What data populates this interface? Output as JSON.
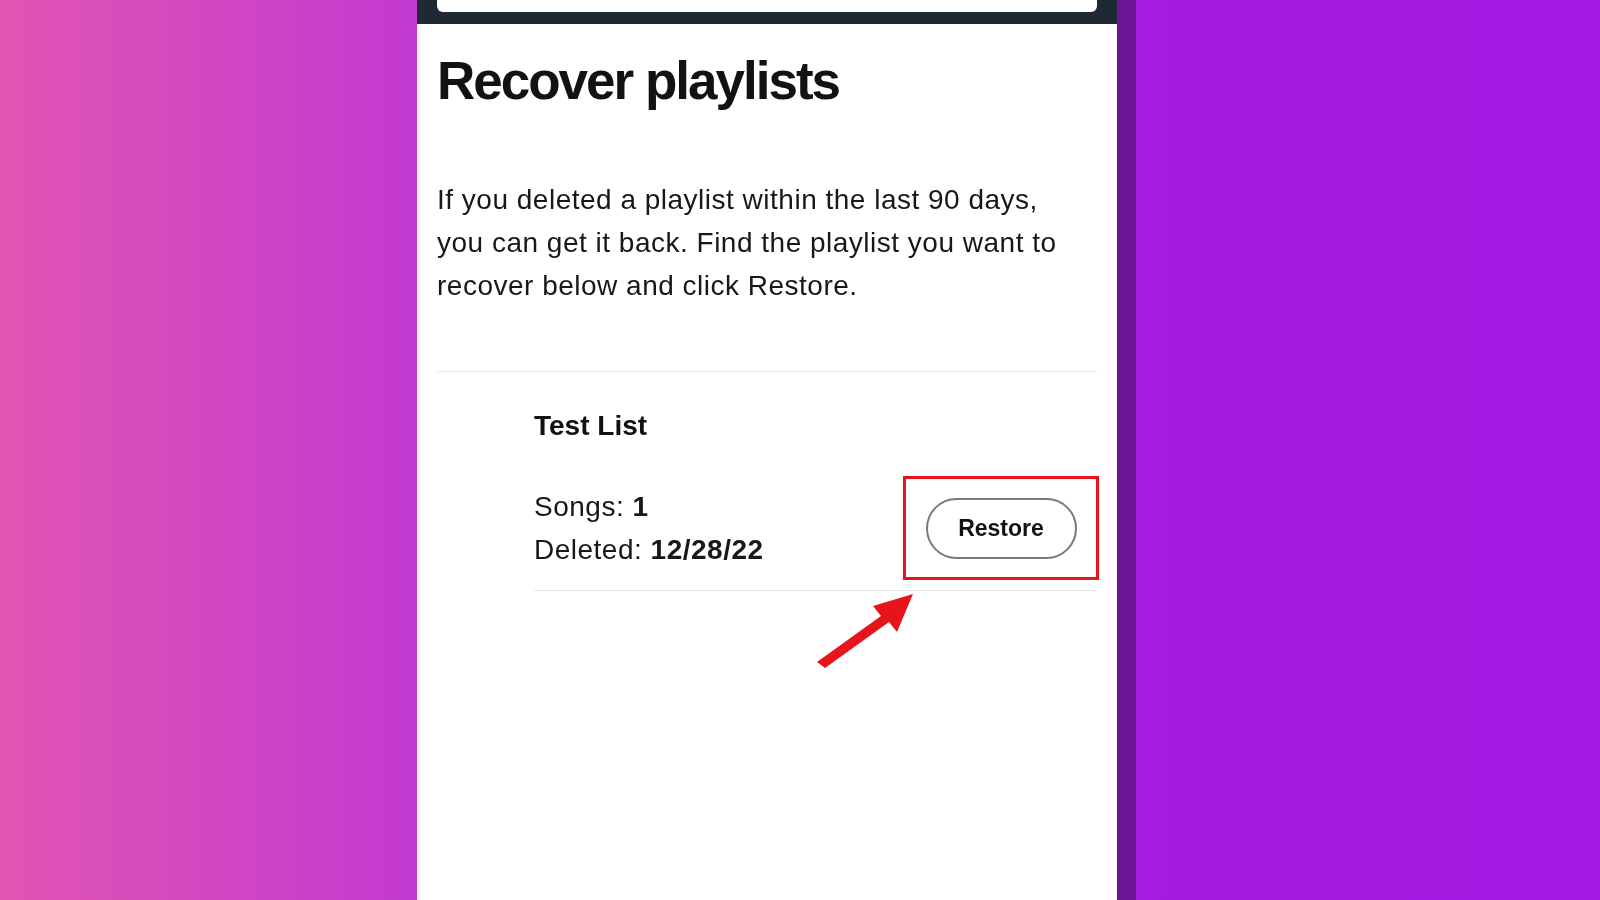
{
  "title": "Recover playlists",
  "intro": "If you deleted a playlist within the last 90 days, you can get it back. Find the playlist you want to recover below and click Restore.",
  "playlists": [
    {
      "name": "Test List",
      "songs_label": "Songs:",
      "songs": "1",
      "deleted_label": "Deleted:",
      "deleted": "12/28/22",
      "action": "Restore",
      "highlighted": true
    }
  ]
}
